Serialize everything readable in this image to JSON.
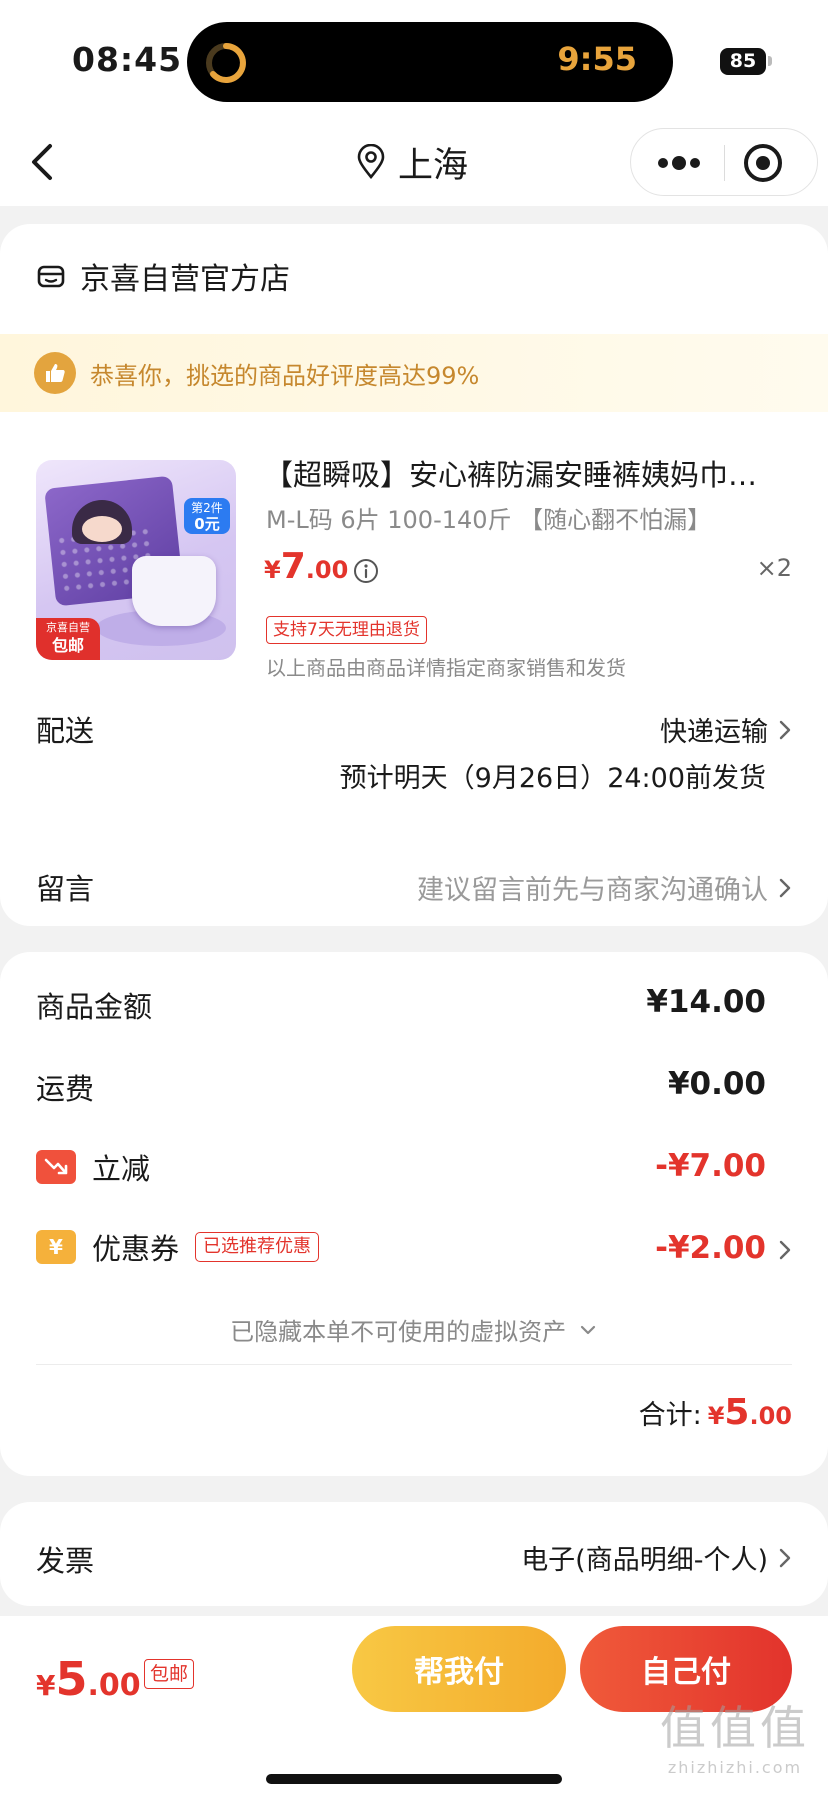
{
  "status_bar": {
    "time": "08:45",
    "island_time": "9:55",
    "battery": "85"
  },
  "nav": {
    "location": "上海"
  },
  "store": {
    "name": "京喜自营官方店"
  },
  "notice": {
    "text": "恭喜你，挑选的商品好评度高达99%"
  },
  "product": {
    "title": "【超瞬吸】安心裤防漏安睡裤姨妈巾…",
    "spec": "M-L码 6片 100-140斤 【随心翻不怕漏】",
    "price_symbol": "¥",
    "price_int": "7",
    "price_dec": ".00",
    "quantity": "×2",
    "return_tag": "支持7天无理由退货",
    "seller_note": "以上商品由商品详情指定商家销售和发货",
    "image": {
      "promo_line1": "第2件",
      "promo_line2": "0元",
      "badge_line1": "京喜自营",
      "badge_line2": "包邮"
    }
  },
  "delivery": {
    "label": "配送",
    "method": "快递运输",
    "eta": "预计明天（9月26日）24:00前发货"
  },
  "message": {
    "label": "留言",
    "hint": "建议留言前先与商家沟通确认"
  },
  "amounts": {
    "subtotal_label": "商品金额",
    "subtotal_value": "¥14.00",
    "shipping_label": "运费",
    "shipping_value": "¥0.00",
    "discount_label": "立减",
    "discount_value": "-¥7.00",
    "coupon_label": "优惠券",
    "coupon_icon_text": "¥",
    "coupon_tag": "已选推荐优惠",
    "coupon_value": "-¥2.00",
    "hidden_assets": "已隐藏本单不可使用的虚拟资产",
    "total_label": "合计:",
    "total_symbol": "¥",
    "total_int": "5",
    "total_dec": ".00"
  },
  "invoice": {
    "label": "发票",
    "value": "电子(商品明细-个人)"
  },
  "bottom_bar": {
    "price_symbol": "¥",
    "price_int": "5",
    "price_dec": ".00",
    "free_shipping": "包邮",
    "help_pay": "帮我付",
    "self_pay": "自己付"
  },
  "watermark": {
    "big": "值值值",
    "small": "zhizhizhi.com"
  },
  "colors": {
    "price_red": "#e3342c",
    "notice_text": "#c6882e",
    "help_btn": "#f5b93a",
    "self_btn": "#e73b2f"
  }
}
